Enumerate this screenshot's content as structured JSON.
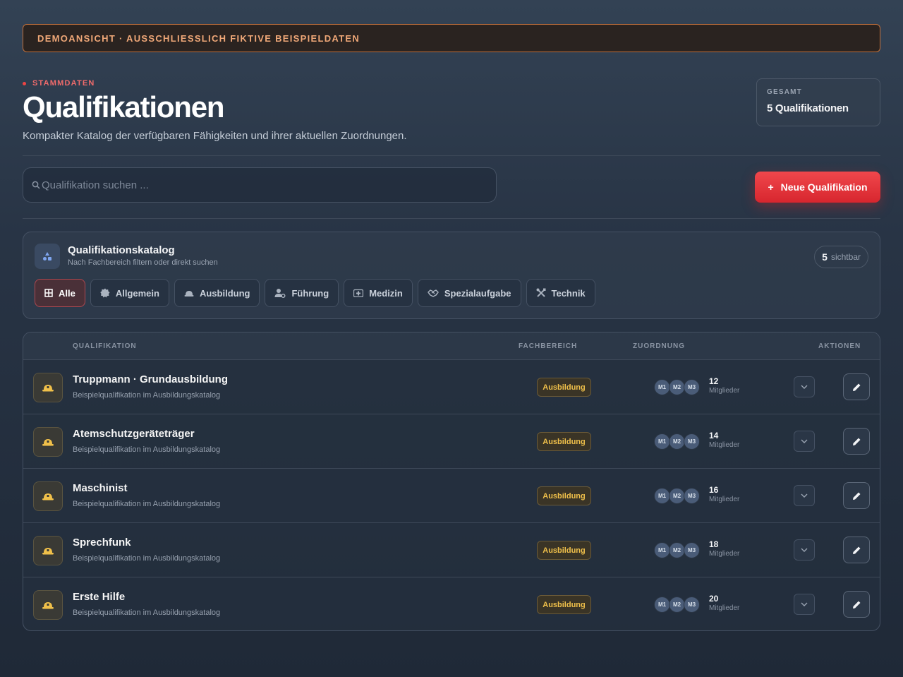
{
  "banner": "DEMOANSICHT · AUSSCHLIESSLICH FIKTIVE BEISPIELDATEN",
  "header": {
    "eyebrow": "STAMMDATEN",
    "title": "Qualifikationen",
    "subtitle": "Kompakter Katalog der verfügbaren Fähigkeiten und ihrer aktuellen Zuordnungen."
  },
  "total": {
    "label": "GESAMT",
    "value": "5 Qualifikationen"
  },
  "search": {
    "placeholder": "Qualifikation suchen ..."
  },
  "new_button": {
    "plus": "+",
    "label": "Neue Qualifikation"
  },
  "catalog": {
    "title": "Qualifikationskatalog",
    "subtitle": "Nach Fachbereich filtern oder direkt suchen",
    "visible_count": "5",
    "visible_label": "sichtbar",
    "filters": [
      {
        "label": "Alle",
        "icon": "grid-icon",
        "active": true
      },
      {
        "label": "Allgemein",
        "icon": "badge-icon",
        "active": false
      },
      {
        "label": "Ausbildung",
        "icon": "helmet-icon",
        "active": false
      },
      {
        "label": "Führung",
        "icon": "user-gear-icon",
        "active": false
      },
      {
        "label": "Medizin",
        "icon": "medical-kit-icon",
        "active": false
      },
      {
        "label": "Spezialaufgabe",
        "icon": "handshake-icon",
        "active": false
      },
      {
        "label": "Technik",
        "icon": "tools-icon",
        "active": false
      }
    ]
  },
  "table": {
    "columns": {
      "name": "QUALIFIKATION",
      "area": "FACHBEREICH",
      "assignment": "ZUORDNUNG",
      "actions": "AKTIONEN"
    },
    "rows": [
      {
        "name": "Truppmann · Grundausbildung",
        "desc": "Beispielqualifikation im Ausbildungskatalog",
        "area": "Ausbildung",
        "avatars": [
          "M1",
          "M2",
          "M3"
        ],
        "count": "12",
        "count_label": "Mitglieder"
      },
      {
        "name": "Atemschutzgeräteträger",
        "desc": "Beispielqualifikation im Ausbildungskatalog",
        "area": "Ausbildung",
        "avatars": [
          "M1",
          "M2",
          "M3"
        ],
        "count": "14",
        "count_label": "Mitglieder"
      },
      {
        "name": "Maschinist",
        "desc": "Beispielqualifikation im Ausbildungskatalog",
        "area": "Ausbildung",
        "avatars": [
          "M1",
          "M2",
          "M3"
        ],
        "count": "16",
        "count_label": "Mitglieder"
      },
      {
        "name": "Sprechfunk",
        "desc": "Beispielqualifikation im Ausbildungskatalog",
        "area": "Ausbildung",
        "avatars": [
          "M1",
          "M2",
          "M3"
        ],
        "count": "18",
        "count_label": "Mitglieder"
      },
      {
        "name": "Erste Hilfe",
        "desc": "Beispielqualifikation im Ausbildungskatalog",
        "area": "Ausbildung",
        "avatars": [
          "M1",
          "M2",
          "M3"
        ],
        "count": "20",
        "count_label": "Mitglieder"
      }
    ]
  },
  "colors": {
    "accent": "#e0323a",
    "badge_text": "#f0c04a",
    "banner_text": "#f0a878"
  }
}
